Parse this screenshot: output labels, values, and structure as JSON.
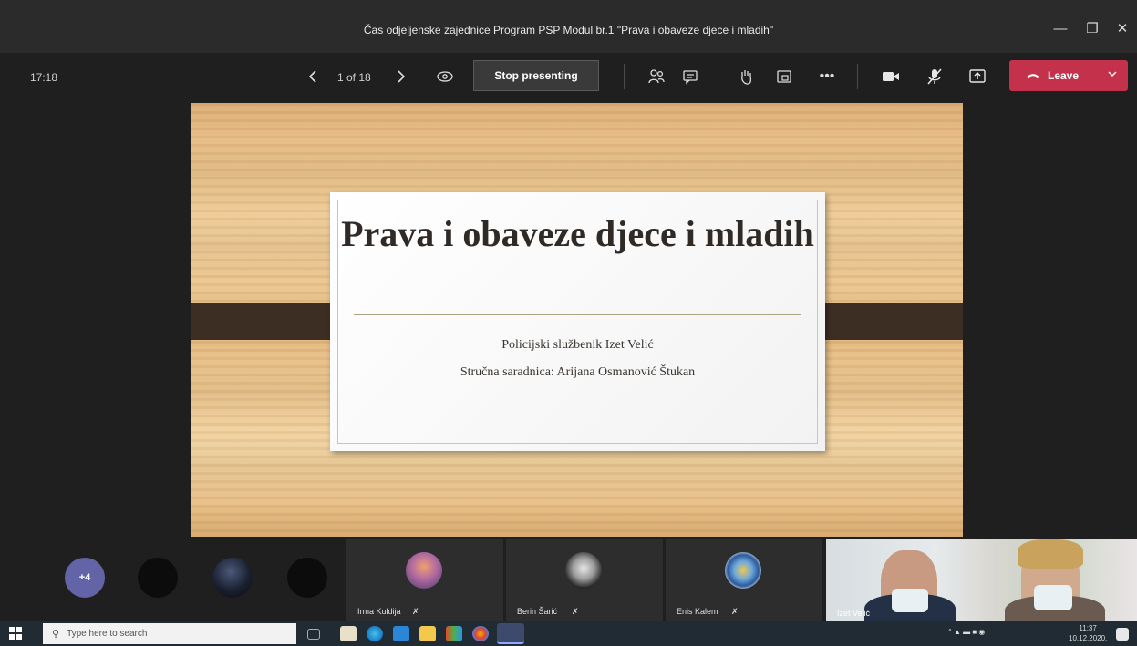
{
  "window": {
    "title": "Čas odjeljenske zajednice Program PSP Modul br.1 \"Prava i obaveze djece i mladih\"",
    "minimize_icon": "minimize-icon",
    "maximize_icon": "maximize-icon",
    "close_icon": "close-icon"
  },
  "toolbar": {
    "meeting_time": "17:18",
    "page_count": "1 of 18",
    "stop_presenting_label": "Stop presenting",
    "leave_label": "Leave",
    "icons": [
      "chevron-left-icon",
      "chevron-right-icon",
      "eye-icon",
      "participants-icon",
      "chat-icon",
      "raise-hand-icon",
      "breakout-rooms-icon",
      "more-icon",
      "camera-icon",
      "mic-off-icon",
      "share-icon",
      "phone-icon",
      "chevron-down-icon"
    ]
  },
  "slide": {
    "title": "Prava i obaveze djece i mladih",
    "line1": "Policijski službenik Izet Velić",
    "line2": "Stručna saradnica: Arijana Osmanović Štukan"
  },
  "participants": {
    "overflow_count": "+4",
    "tiles": [
      {
        "name": "Irma Kuldija"
      },
      {
        "name": "Berin Šarić"
      },
      {
        "name": "Enis Kalem"
      }
    ],
    "video_name": "Izet Velić"
  },
  "taskbar": {
    "search_placeholder": "Type here to search",
    "time": "11:37",
    "date": "10.12.2020."
  },
  "colors": {
    "leave": "#c4314b",
    "more_badge": "#6264a7",
    "slide_band": "#3d2e24"
  }
}
